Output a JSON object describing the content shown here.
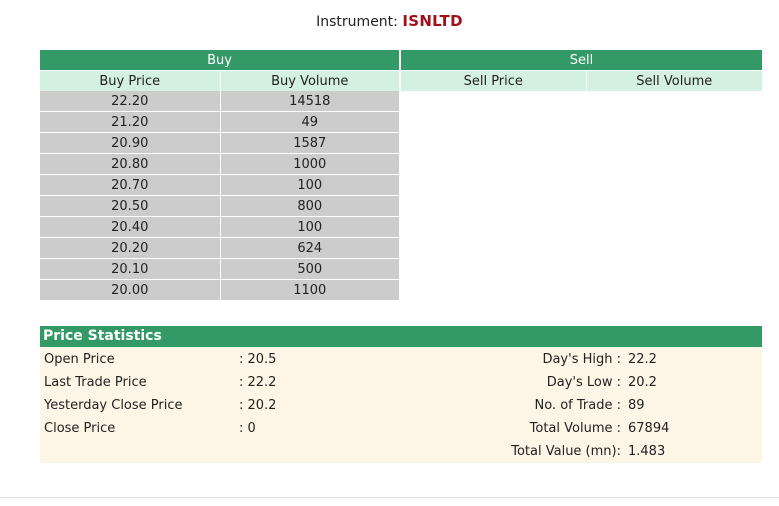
{
  "instrument": {
    "label": "Instrument:",
    "code": "ISNLTD"
  },
  "book": {
    "buy_title": "Buy",
    "sell_title": "Sell",
    "headers": {
      "buy_price": "Buy Price",
      "buy_volume": "Buy Volume",
      "sell_price": "Sell Price",
      "sell_volume": "Sell Volume"
    },
    "buy_rows": [
      {
        "price": "22.20",
        "volume": "14518"
      },
      {
        "price": "21.20",
        "volume": "49"
      },
      {
        "price": "20.90",
        "volume": "1587"
      },
      {
        "price": "20.80",
        "volume": "1000"
      },
      {
        "price": "20.70",
        "volume": "100"
      },
      {
        "price": "20.50",
        "volume": "800"
      },
      {
        "price": "20.40",
        "volume": "100"
      },
      {
        "price": "20.20",
        "volume": "624"
      },
      {
        "price": "20.10",
        "volume": "500"
      },
      {
        "price": "20.00",
        "volume": "1100"
      }
    ],
    "sell_rows": []
  },
  "stats": {
    "title": "Price Statistics",
    "left": [
      {
        "label": "Open Price",
        "value": ": 20.5"
      },
      {
        "label": "Last Trade Price",
        "value": ": 22.2"
      },
      {
        "label": "Yesterday Close Price",
        "value": ": 20.2"
      },
      {
        "label": "Close Price",
        "value": ": 0"
      }
    ],
    "right": [
      {
        "label": "Day's High :",
        "value": "22.2"
      },
      {
        "label": "Day's Low :",
        "value": "20.2"
      },
      {
        "label": "No. of Trade :",
        "value": "89"
      },
      {
        "label": "Total Volume :",
        "value": "67894"
      },
      {
        "label": "Total Value (mn):",
        "value": "1.483"
      }
    ]
  }
}
